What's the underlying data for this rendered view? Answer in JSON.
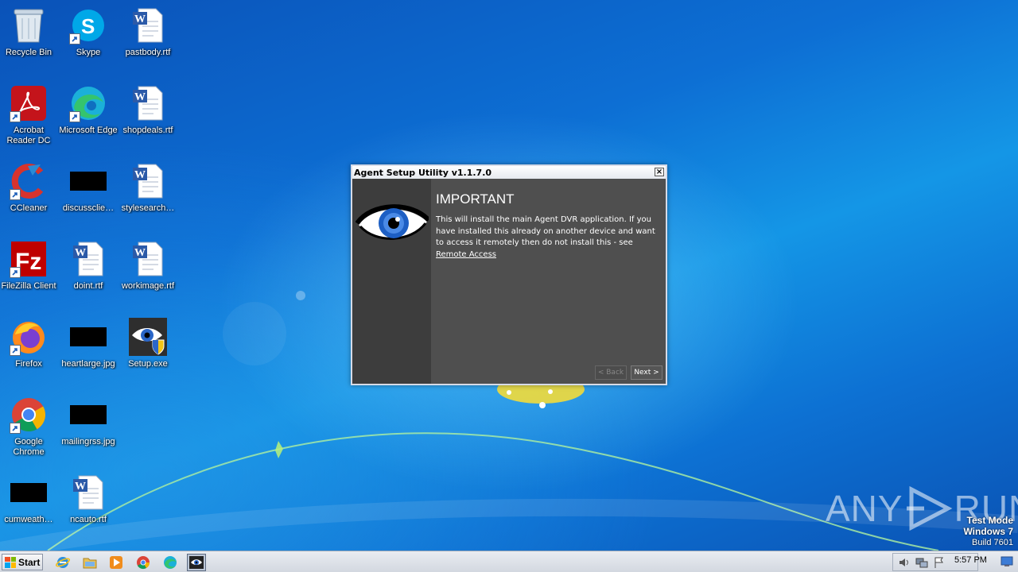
{
  "desktop": {
    "icons": [
      {
        "label": "Recycle Bin",
        "icon": "recycle-bin-icon"
      },
      {
        "label": "Skype",
        "icon": "skype-icon"
      },
      {
        "label": "pastbody.rtf",
        "icon": "word-document-icon"
      },
      {
        "label": "Acrobat Reader DC",
        "icon": "acrobat-reader-icon"
      },
      {
        "label": "Microsoft Edge",
        "icon": "edge-icon"
      },
      {
        "label": "shopdeals.rtf",
        "icon": "word-document-icon"
      },
      {
        "label": "CCleaner",
        "icon": "ccleaner-icon"
      },
      {
        "label": "discussclie…",
        "icon": "black-thumbnail-icon"
      },
      {
        "label": "stylesearch…",
        "icon": "word-document-icon"
      },
      {
        "label": "FileZilla Client",
        "icon": "filezilla-icon"
      },
      {
        "label": "doint.rtf",
        "icon": "word-document-icon"
      },
      {
        "label": "workimage.rtf",
        "icon": "word-document-icon"
      },
      {
        "label": "Firefox",
        "icon": "firefox-icon"
      },
      {
        "label": "heartlarge.jpg",
        "icon": "black-thumbnail-icon"
      },
      {
        "label": "Setup.exe",
        "icon": "agent-eye-shield-icon"
      },
      {
        "label": "Google Chrome",
        "icon": "chrome-icon"
      },
      {
        "label": "mailingrss.jpg",
        "icon": "black-thumbnail-icon"
      },
      {
        "label": "cumweath…",
        "icon": "black-thumbnail-icon"
      },
      {
        "label": "ncauto.rtf",
        "icon": "word-document-icon"
      }
    ]
  },
  "dialog": {
    "title": "Agent Setup Utility v1.1.7.0",
    "close_label": "×",
    "heading": "IMPORTANT",
    "body": "This will install the main Agent DVR application. If you have installed this already on another device and want to access it remotely then do not install this - see",
    "link": "Remote Access",
    "back_label": "< Back",
    "next_label": "Next >"
  },
  "taskbar": {
    "start_label": "Start",
    "clock": "5:57 PM",
    "pinned": [
      "internet-explorer-icon",
      "file-explorer-icon",
      "media-player-icon",
      "chrome-icon",
      "edge-icon",
      "agent-setup-icon"
    ]
  },
  "watermark": {
    "brand_left": "ANY",
    "brand_right": "RUN",
    "line1": "Test Mode",
    "line2": "Windows 7",
    "line3": "Build 7601"
  }
}
